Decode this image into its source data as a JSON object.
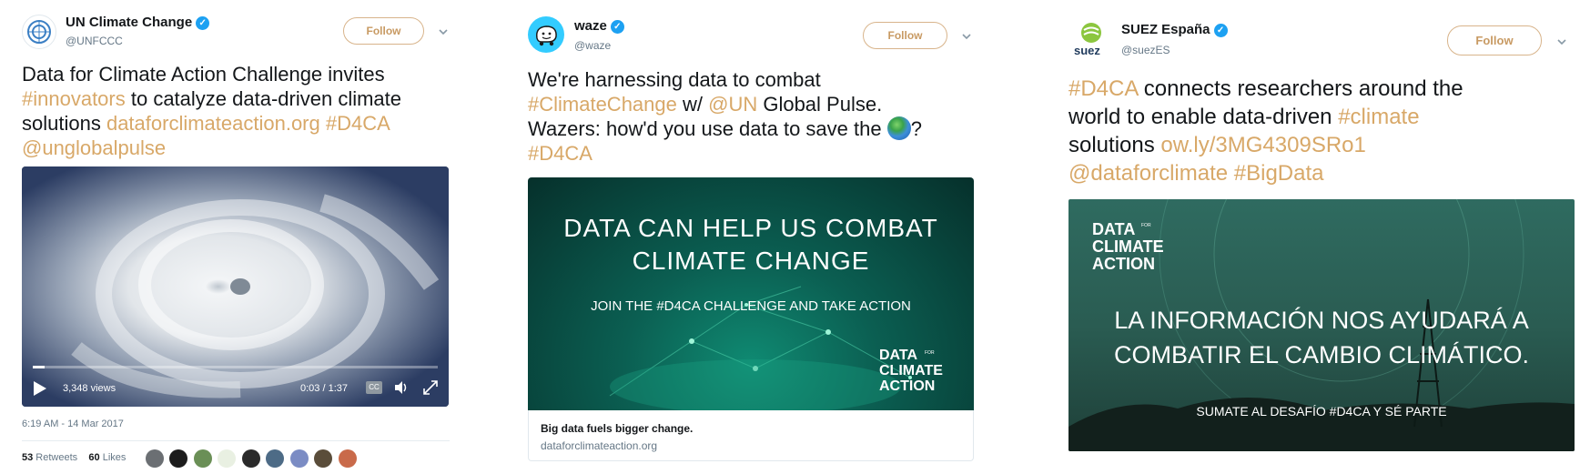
{
  "tweet1": {
    "name": "UN Climate Change",
    "handle": "@UNFCCC",
    "follow_label": "Follow",
    "text_a": "Data for Climate Action Challenge invites",
    "text_b_link": "#innovators",
    "text_b": " to catalyze data-driven climate",
    "text_c": "solutions ",
    "text_c_link1": "dataforclimateaction.org",
    "text_c_link2": " #D4CA",
    "text_d_link": "@unglobalpulse",
    "video": {
      "views": "3,348 views",
      "time": "0:03 / 1:37",
      "cc": "CC",
      "progress": 0.03
    },
    "timestamp": "6:19 AM - 14 Mar 2017",
    "retweets_count": "53",
    "retweets_label": " Retweets",
    "likes_count": "60",
    "likes_label": " Likes"
  },
  "tweet2": {
    "name": "waze",
    "handle": "@waze",
    "follow_label": "Follow",
    "text_a": "We're harnessing data to combat",
    "text_b_link1": "#ClimateChange",
    "text_b": " w/ ",
    "text_b_link2": "@UN",
    "text_b2": " Global Pulse.",
    "text_c": "Wazers: how'd you use data to save the ",
    "text_c_end": "?",
    "text_d_link": "#D4CA",
    "image": {
      "line1": "DATA CAN HELP US COMBAT",
      "line2": "CLIMATE CHANGE",
      "line3": "JOIN THE #D4CA CHALLENGE AND TAKE ACTION",
      "logo1": "DATA",
      "logo2": "CLIMATE",
      "logo3": "ACTION",
      "logo_for": "FOR"
    },
    "card_title": "Big data fuels bigger change.",
    "card_domain": "dataforclimateaction.org"
  },
  "tweet3": {
    "name": "SUEZ España",
    "handle": "@suezES",
    "logo_text": "suez",
    "follow_label": "Follow",
    "text_a_link": "#D4CA",
    "text_a": " connects researchers around the",
    "text_b": "world to enable data-driven ",
    "text_b_link": "#climate",
    "text_c": "solutions ",
    "text_c_link": "ow.ly/3MG4309SRo1",
    "text_d_link": "@dataforclimate #BigData",
    "image": {
      "logo1": "DATA",
      "logo2": "CLIMATE",
      "logo3": "ACTION",
      "logo_for": "FOR",
      "line1": "LA INFORMACIÓN NOS AYUDARÁ A",
      "line2": "COMBATIR EL CAMBIO CLIMÁTICO.",
      "line3": "SUMATE AL DESAFÍO #D4CA Y SÉ PARTE"
    }
  },
  "colors": {
    "link": "#d8a868",
    "verified": "#1da1f2",
    "follow_border": "#d8b48b"
  }
}
